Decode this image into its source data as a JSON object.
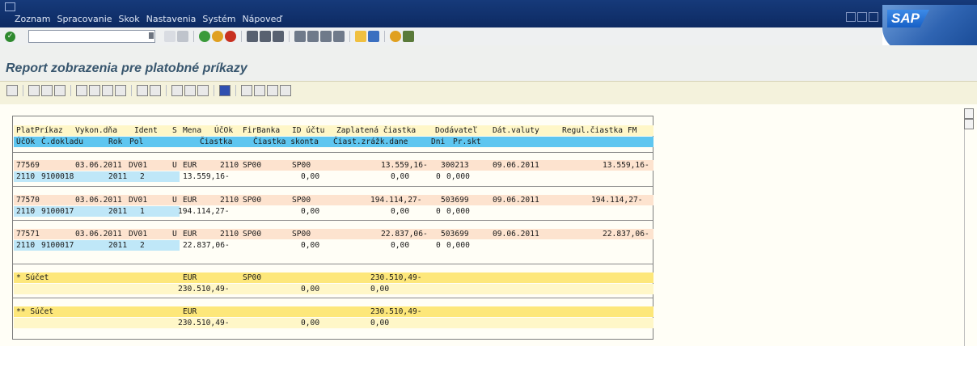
{
  "menu": [
    "Zoznam",
    "Spracovanie",
    "Skok",
    "Nastavenia",
    "Systém",
    "Nápoveď"
  ],
  "logo": "SAP",
  "title": "Report zobrazenia pre platobné príkazy",
  "header1": {
    "platprikaz": "PlatPríkaz",
    "vykon_dna": "Vykon.dňa",
    "ident": "Ident",
    "s": "S",
    "mena": "Mena",
    "ucok": "ÚčOk",
    "firbanka": "FirBanka",
    "id_uctu": "ID účtu",
    "zaplatena": "Zaplatená čiastka",
    "dodavatel": "Dodávateľ",
    "dat_valuty": "Dát.valuty",
    "regul": "Regul.čiastka FM"
  },
  "header2": {
    "ucok": "ÚčOk",
    "c_dokladu": "Č.dokladu",
    "rok": "Rok",
    "pol": "Pol",
    "ciastka": "Čiastka",
    "ciastka_skonta": "Čiastka skonta",
    "ciast_zrazk": "Čiast.zrážk.dane",
    "dni": "Dni",
    "pr_skt": "Pr.skt"
  },
  "records": [
    {
      "platprikaz": "77569",
      "vykon": "03.06.2011",
      "ident": "DV01",
      "s": "U",
      "mena": "EUR",
      "ucok": "2110",
      "firbanka": "SP00",
      "id_uctu": "SP00",
      "zaplatena": "13.559,16-",
      "dodavatel": "300213",
      "dat": "09.06.2011",
      "regul": "13.559,16-",
      "sub": {
        "ucok": "2110",
        "doklad": "9100018",
        "rok": "2011",
        "pol": "2",
        "ciastka": "13.559,16-",
        "skonto": "0,00",
        "zrazk": "0,00",
        "dni": "0",
        "prskt": "0,000"
      }
    },
    {
      "platprikaz": "77570",
      "vykon": "03.06.2011",
      "ident": "DV01",
      "s": "U",
      "mena": "EUR",
      "ucok": "2110",
      "firbanka": "SP00",
      "id_uctu": "SP00",
      "zaplatena": "194.114,27-",
      "dodavatel": "503699",
      "dat": "09.06.2011",
      "regul": "194.114,27-",
      "sub": {
        "ucok": "2110",
        "doklad": "9100017",
        "rok": "2011",
        "pol": "1",
        "ciastka": "194.114,27-",
        "skonto": "0,00",
        "zrazk": "0,00",
        "dni": "0",
        "prskt": "0,000"
      }
    },
    {
      "platprikaz": "77571",
      "vykon": "03.06.2011",
      "ident": "DV01",
      "s": "U",
      "mena": "EUR",
      "ucok": "2110",
      "firbanka": "SP00",
      "id_uctu": "SP00",
      "zaplatena": "22.837,06-",
      "dodavatel": "503699",
      "dat": "09.06.2011",
      "regul": "22.837,06-",
      "sub": {
        "ucok": "2110",
        "doklad": "9100017",
        "rok": "2011",
        "pol": "2",
        "ciastka": "22.837,06-",
        "skonto": "0,00",
        "zrazk": "0,00",
        "dni": "0",
        "prskt": "0,000"
      }
    }
  ],
  "sum1": {
    "label": "* Súčet",
    "mena": "EUR",
    "firbanka": "SP00",
    "zaplatena": "230.510,49-",
    "ciastka": "230.510,49-",
    "skonto": "0,00",
    "zrazk": "0,00"
  },
  "sum2": {
    "label": "** Súčet",
    "mena": "EUR",
    "zaplatena": "230.510,49-",
    "ciastka": "230.510,49-",
    "skonto": "0,00",
    "zrazk": "0,00"
  }
}
